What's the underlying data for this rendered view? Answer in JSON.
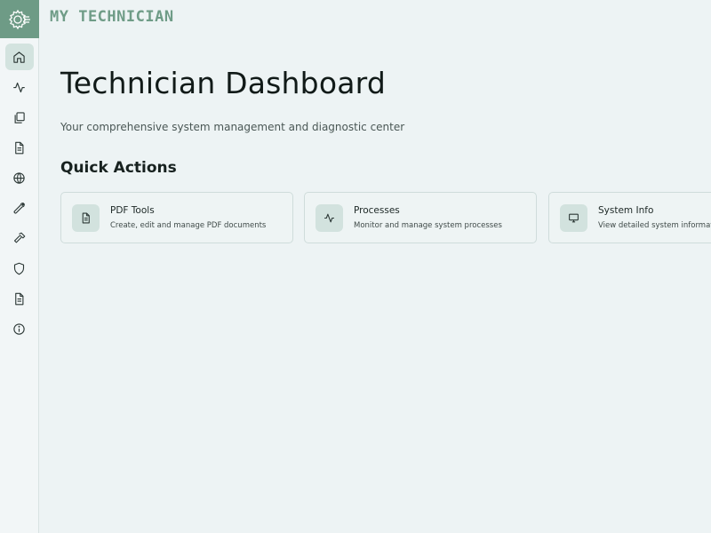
{
  "app": {
    "brand": "MY TECHNICIAN",
    "logo_icon": "gear-circuit-icon",
    "accent_color": "#6e9b86"
  },
  "sidebar": {
    "items": [
      {
        "icon": "home-icon",
        "active": true
      },
      {
        "icon": "activity-icon",
        "active": false
      },
      {
        "icon": "copy-icon",
        "active": false
      },
      {
        "icon": "document-icon",
        "active": false
      },
      {
        "icon": "globe-icon",
        "active": false
      },
      {
        "icon": "wrench-icon",
        "active": false
      },
      {
        "icon": "hammer-icon",
        "active": false
      },
      {
        "icon": "shield-icon",
        "active": false
      },
      {
        "icon": "file-text-icon",
        "active": false
      },
      {
        "icon": "info-icon",
        "active": false
      }
    ]
  },
  "main": {
    "title": "Technician Dashboard",
    "subtitle": "Your comprehensive system management and diagnostic center",
    "quick_actions_title": "Quick Actions",
    "cards": [
      {
        "title": "PDF Tools",
        "description": "Create, edit and manage PDF documents",
        "icon": "document-icon"
      },
      {
        "title": "Processes",
        "description": "Monitor and manage system processes",
        "icon": "activity-icon"
      },
      {
        "title": "System Info",
        "description": "View detailed system information",
        "icon": "monitor-icon"
      }
    ]
  }
}
